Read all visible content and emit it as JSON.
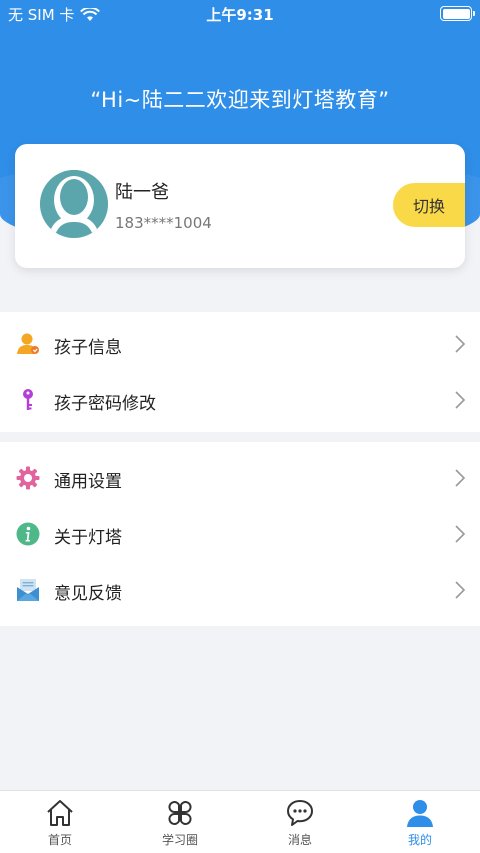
{
  "status_bar": {
    "carrier": "无 SIM 卡",
    "time": "上午9:31"
  },
  "header": {
    "greeting": "“Hi~陆二二欢迎来到灯塔教育”"
  },
  "profile": {
    "name": "陆一爸",
    "phone": "183****1004",
    "switch_label": "切换"
  },
  "menu_groups": [
    {
      "items": [
        {
          "label": "孩子信息",
          "icon": "person-icon"
        },
        {
          "label": "孩子密码修改",
          "icon": "key-icon"
        }
      ]
    },
    {
      "items": [
        {
          "label": "通用设置",
          "icon": "gear-icon"
        },
        {
          "label": "关于灯塔",
          "icon": "info-icon"
        },
        {
          "label": "意见反馈",
          "icon": "envelope-icon"
        }
      ]
    }
  ],
  "tabs": [
    {
      "label": "首页",
      "icon": "home-icon",
      "active": false
    },
    {
      "label": "学习圈",
      "icon": "clover-icon",
      "active": false
    },
    {
      "label": "消息",
      "icon": "chat-bubble-icon",
      "active": false
    },
    {
      "label": "我的",
      "icon": "user-icon",
      "active": true
    }
  ],
  "colors": {
    "primary": "#2f8ee8",
    "switch_button": "#fad949",
    "background": "#f2f3f7"
  }
}
